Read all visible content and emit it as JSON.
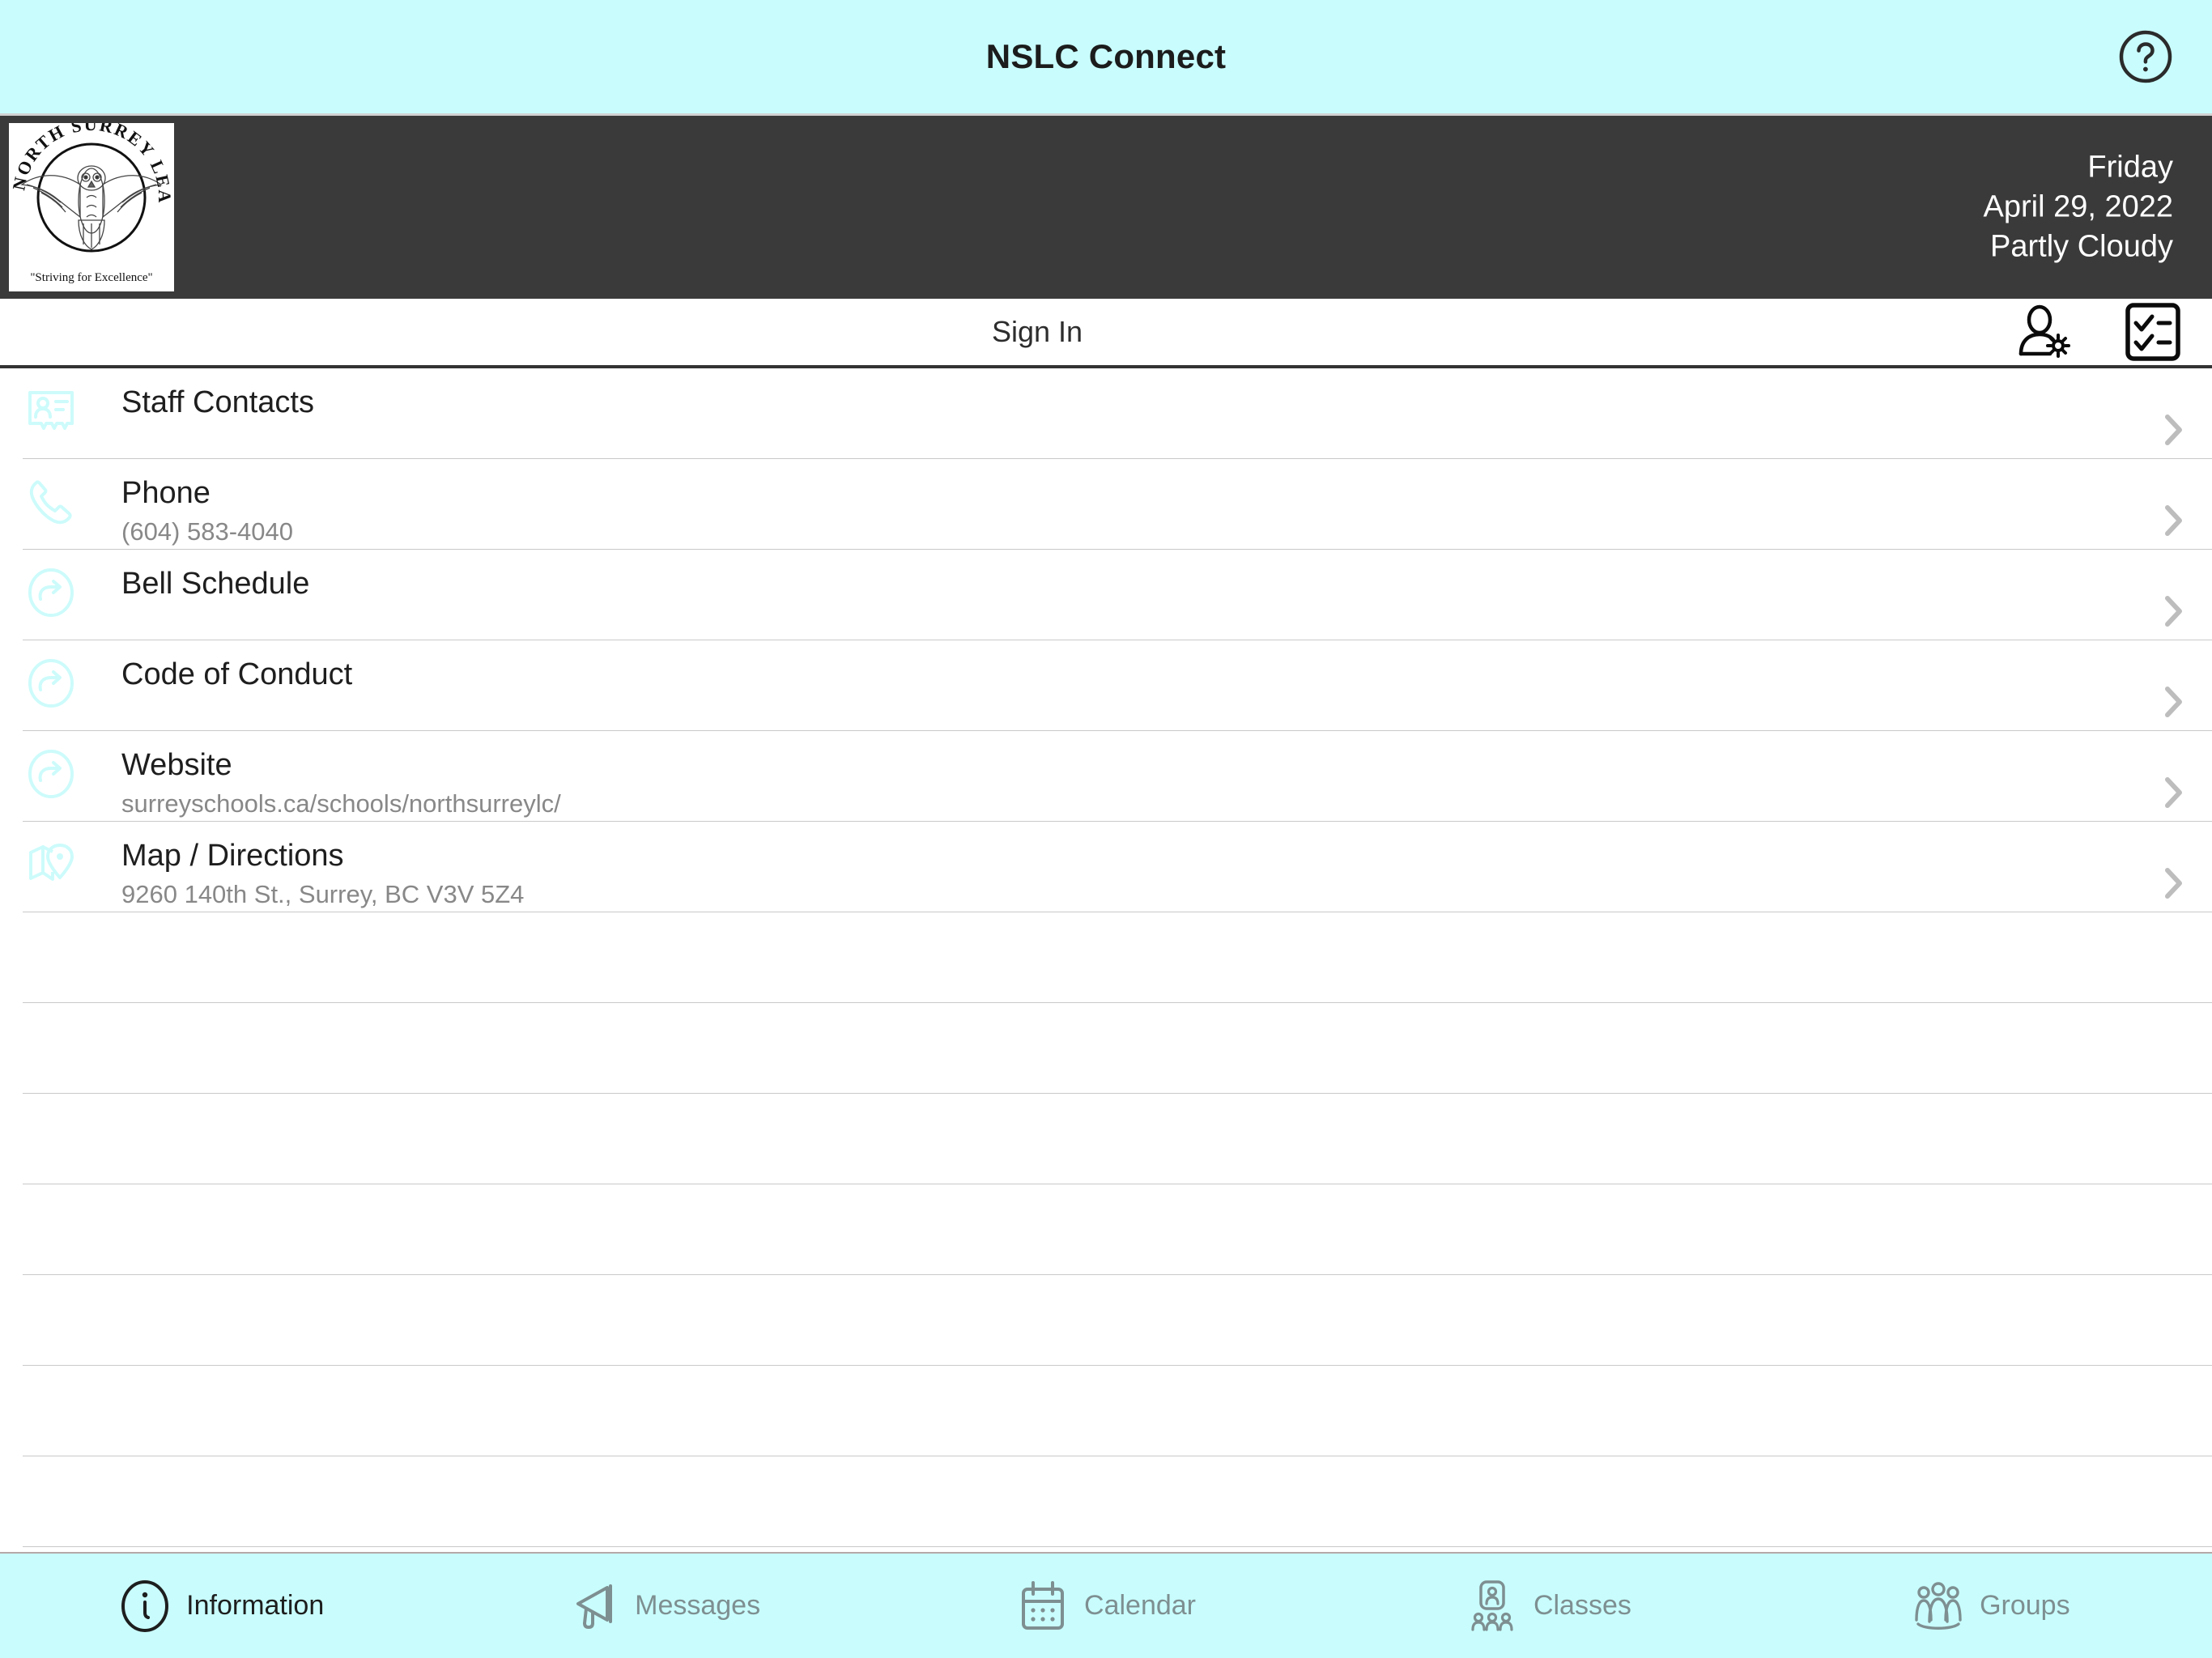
{
  "titlebar": {
    "title": "NSLC Connect",
    "help_icon": "help-circle-icon"
  },
  "school_header": {
    "logo_alt": "NORTH SURREY LEARNING CENTRE",
    "logo_top_text": "NORTH SURREY LEARNING CENTRE",
    "logo_motto": "\"Striving for Excellence\"",
    "day": "Friday",
    "date": "April 29, 2022",
    "weather": "Partly Cloudy"
  },
  "signin_bar": {
    "label": "Sign In",
    "account_settings_icon": "user-gear-icon",
    "checklist_icon": "checklist-icon"
  },
  "list": {
    "rows": [
      {
        "title": "Staff Contacts",
        "subtitle": "",
        "icon": "contact-card-icon"
      },
      {
        "title": "Phone",
        "subtitle": "(604) 583-4040",
        "icon": "phone-icon"
      },
      {
        "title": "Bell Schedule",
        "subtitle": "",
        "icon": "external-link-icon"
      },
      {
        "title": "Code of Conduct",
        "subtitle": "",
        "icon": "external-link-icon"
      },
      {
        "title": "Website",
        "subtitle": "surreyschools.ca/schools/northsurreylc/",
        "icon": "external-link-icon"
      },
      {
        "title": "Map / Directions",
        "subtitle": "9260 140th St., Surrey, BC V3V 5Z4",
        "icon": "map-pin-icon"
      }
    ],
    "empty_row_count": 7,
    "chevron_icon": "chevron-right-icon"
  },
  "tabbar": {
    "tabs": [
      {
        "label": "Information",
        "icon": "info-circle-icon",
        "active": true
      },
      {
        "label": "Messages",
        "icon": "megaphone-icon",
        "active": false
      },
      {
        "label": "Calendar",
        "icon": "calendar-icon",
        "active": false
      },
      {
        "label": "Classes",
        "icon": "classes-icon",
        "active": false
      },
      {
        "label": "Groups",
        "icon": "groups-icon",
        "active": false
      }
    ]
  },
  "colors": {
    "accent_cyan": "#c9fdfd",
    "header_dark": "#3a3a3a",
    "icon_tint": "#cdfbfb",
    "tab_inactive": "#7e8f91",
    "tab_active": "#1e1e1e",
    "subtitle_gray": "#888888",
    "separator": "#c9c9c9"
  }
}
